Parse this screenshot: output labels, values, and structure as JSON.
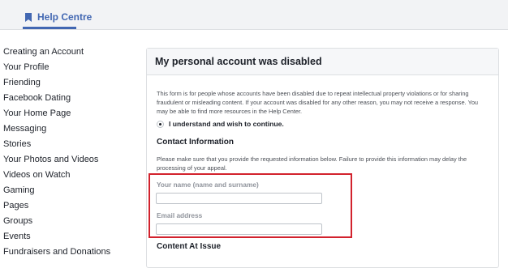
{
  "header": {
    "brand_label": "Help Centre",
    "brand_icon": "bookmark-icon",
    "accent_color": "#4267b2"
  },
  "sidebar": {
    "items": [
      {
        "label": "Creating an Account"
      },
      {
        "label": "Your Profile"
      },
      {
        "label": "Friending"
      },
      {
        "label": "Facebook Dating"
      },
      {
        "label": "Your Home Page"
      },
      {
        "label": "Messaging"
      },
      {
        "label": "Stories"
      },
      {
        "label": "Your Photos and Videos"
      },
      {
        "label": "Videos on Watch"
      },
      {
        "label": "Gaming"
      },
      {
        "label": "Pages"
      },
      {
        "label": "Groups"
      },
      {
        "label": "Events"
      },
      {
        "label": "Fundraisers and Donations"
      }
    ]
  },
  "form": {
    "title": "My personal account was disabled",
    "intro": "This form is for people whose accounts have been disabled due to repeat intellectual property violations or for sharing fraudulent or misleading content. If your account was disabled for any other reason, you may not receive a response. You may be able to find more resources in the Help Center.",
    "consent_label": "I understand and wish to continue.",
    "contact_heading": "Contact Information",
    "contact_help": "Please make sure that you provide the requested information below. Failure to provide this information may delay the processing of your appeal.",
    "name_label": "Your name (name and surname)",
    "name_value": "",
    "email_label": "Email address",
    "email_value": "",
    "content_heading": "Content At Issue"
  },
  "annotation": {
    "highlight_color": "#d2222d"
  }
}
